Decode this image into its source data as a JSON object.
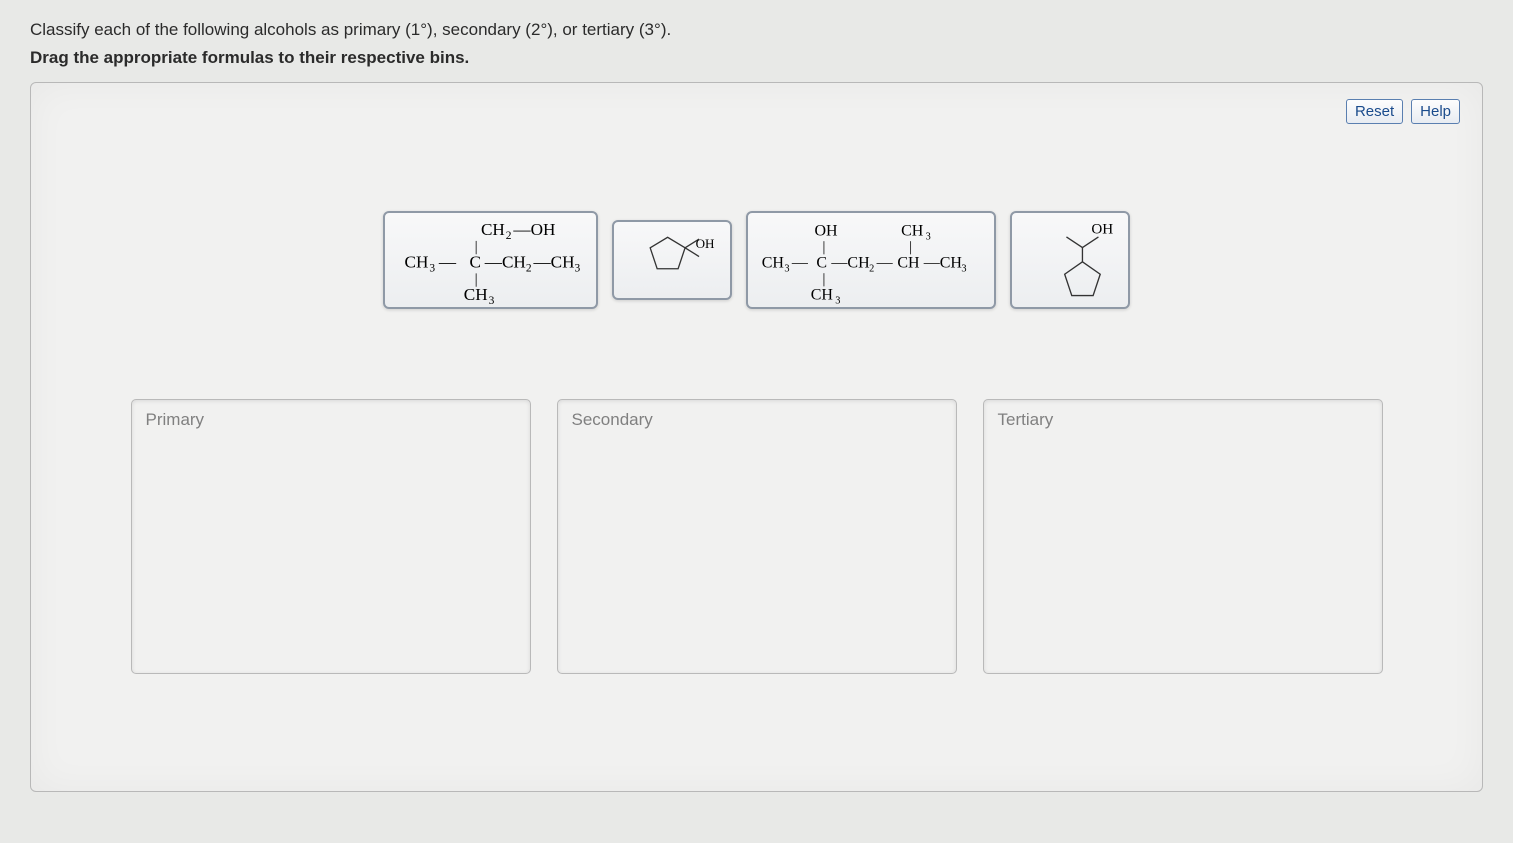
{
  "question": {
    "line1_pre": "Classify each of the following alcohols as primary (1",
    "deg1": "°",
    "line1_mid1": "), secondary (2",
    "line1_mid2": "), or tertiary (3",
    "line1_end": ").",
    "line2": "Drag the appropriate formulas to their respective bins."
  },
  "controls": {
    "reset": "Reset",
    "help": "Help"
  },
  "tiles": {
    "t1": {
      "top": "CH₂—OH",
      "mid_left": "CH₃—",
      "mid_center": "C",
      "mid_right": "—CH₂—CH₃",
      "bottom": "CH₃"
    },
    "t2": {
      "label": "OH"
    },
    "t3": {
      "top_left": "OH",
      "top_right": "CH₃",
      "mid_left": "CH₃—",
      "mid_c": "C",
      "mid_m": "—CH₂—",
      "mid_c2": "CH",
      "mid_right": "—CH₃",
      "bottom": "CH₃"
    },
    "t4": {
      "label": "OH"
    }
  },
  "bins": {
    "primary": "Primary",
    "secondary": "Secondary",
    "tertiary": "Tertiary"
  }
}
